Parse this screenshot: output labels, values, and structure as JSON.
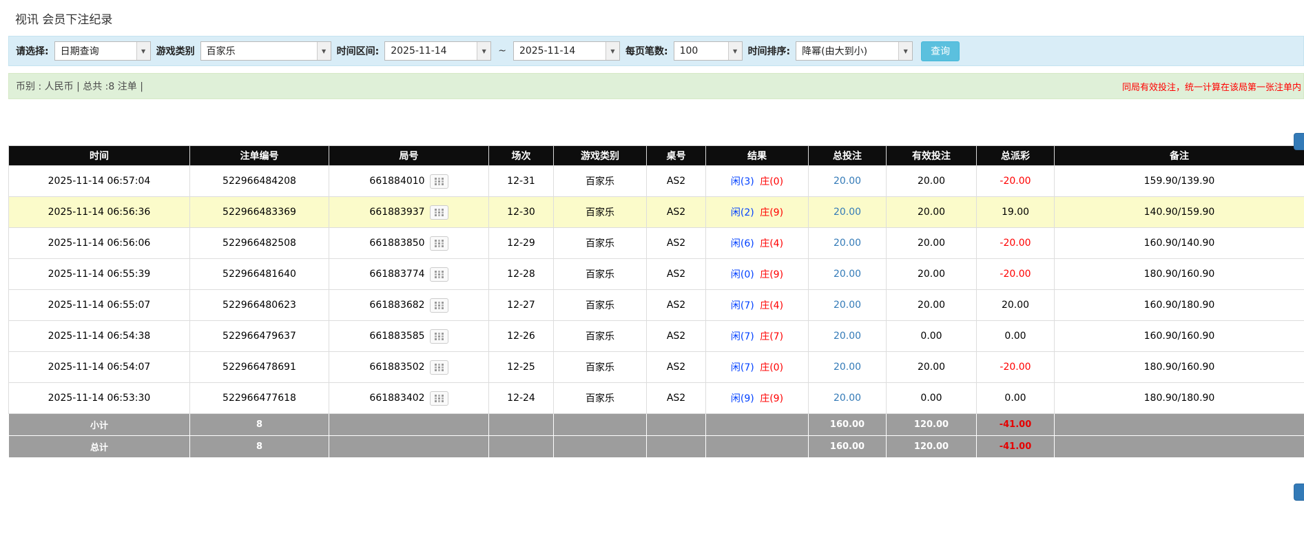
{
  "page": {
    "title": "视讯 会员下注纪录"
  },
  "filter": {
    "select_label": "请选择:",
    "select_value": "日期查询",
    "game_type_label": "游戏类别",
    "game_type_value": "百家乐",
    "time_range_label": "时间区间:",
    "date_from": "2025-11-14",
    "range_separator": "~",
    "date_to": "2025-11-14",
    "page_size_label": "每页笔数:",
    "page_size_value": "100",
    "sort_label": "时间排序:",
    "sort_value": "降幂(由大到小)",
    "search_button": "查询",
    "dropdown_arrow": "▼"
  },
  "summary": {
    "left": "币别 : 人民币 | 总共 :8 注单 |",
    "right_notice": "同局有效投注，统一计算在该局第一张注单内"
  },
  "table": {
    "headers": [
      "时间",
      "注单编号",
      "局号",
      "场次",
      "游戏类别",
      "桌号",
      "结果",
      "总投注",
      "有效投注",
      "总派彩",
      "备注"
    ],
    "rows": [
      {
        "time": "2025-11-14 06:57:04",
        "bet_id": "522966484208",
        "round": "661884010",
        "session": "12-31",
        "game": "百家乐",
        "table_no": "AS2",
        "result_player": "闲(3)",
        "result_banker": "庄(0)",
        "total_bet": "20.00",
        "valid_bet": "20.00",
        "payout": "-20.00",
        "payout_neg": true,
        "highlight": false,
        "remark": "159.90/139.90"
      },
      {
        "time": "2025-11-14 06:56:36",
        "bet_id": "522966483369",
        "round": "661883937",
        "session": "12-30",
        "game": "百家乐",
        "table_no": "AS2",
        "result_player": "闲(2)",
        "result_banker": "庄(9)",
        "total_bet": "20.00",
        "valid_bet": "20.00",
        "payout": "19.00",
        "payout_neg": false,
        "highlight": true,
        "remark": "140.90/159.90"
      },
      {
        "time": "2025-11-14 06:56:06",
        "bet_id": "522966482508",
        "round": "661883850",
        "session": "12-29",
        "game": "百家乐",
        "table_no": "AS2",
        "result_player": "闲(6)",
        "result_banker": "庄(4)",
        "total_bet": "20.00",
        "valid_bet": "20.00",
        "payout": "-20.00",
        "payout_neg": true,
        "highlight": false,
        "remark": "160.90/140.90"
      },
      {
        "time": "2025-11-14 06:55:39",
        "bet_id": "522966481640",
        "round": "661883774",
        "session": "12-28",
        "game": "百家乐",
        "table_no": "AS2",
        "result_player": "闲(0)",
        "result_banker": "庄(9)",
        "total_bet": "20.00",
        "valid_bet": "20.00",
        "payout": "-20.00",
        "payout_neg": true,
        "highlight": false,
        "remark": "180.90/160.90"
      },
      {
        "time": "2025-11-14 06:55:07",
        "bet_id": "522966480623",
        "round": "661883682",
        "session": "12-27",
        "game": "百家乐",
        "table_no": "AS2",
        "result_player": "闲(7)",
        "result_banker": "庄(4)",
        "total_bet": "20.00",
        "valid_bet": "20.00",
        "payout": "20.00",
        "payout_neg": false,
        "highlight": false,
        "remark": "160.90/180.90"
      },
      {
        "time": "2025-11-14 06:54:38",
        "bet_id": "522966479637",
        "round": "661883585",
        "session": "12-26",
        "game": "百家乐",
        "table_no": "AS2",
        "result_player": "闲(7)",
        "result_banker": "庄(7)",
        "total_bet": "20.00",
        "valid_bet": "0.00",
        "payout": "0.00",
        "payout_neg": false,
        "highlight": false,
        "remark": "160.90/160.90"
      },
      {
        "time": "2025-11-14 06:54:07",
        "bet_id": "522966478691",
        "round": "661883502",
        "session": "12-25",
        "game": "百家乐",
        "table_no": "AS2",
        "result_player": "闲(7)",
        "result_banker": "庄(0)",
        "total_bet": "20.00",
        "valid_bet": "20.00",
        "payout": "-20.00",
        "payout_neg": true,
        "highlight": false,
        "remark": "180.90/160.90"
      },
      {
        "time": "2025-11-14 06:53:30",
        "bet_id": "522966477618",
        "round": "661883402",
        "session": "12-24",
        "game": "百家乐",
        "table_no": "AS2",
        "result_player": "闲(9)",
        "result_banker": "庄(9)",
        "total_bet": "20.00",
        "valid_bet": "0.00",
        "payout": "0.00",
        "payout_neg": false,
        "highlight": false,
        "remark": "180.90/180.90"
      }
    ],
    "footer": [
      {
        "label": "小计",
        "count": "8",
        "total_bet": "160.00",
        "valid_bet": "120.00",
        "payout": "-41.00"
      },
      {
        "label": "总计",
        "count": "8",
        "total_bet": "160.00",
        "valid_bet": "120.00",
        "payout": "-41.00"
      }
    ]
  },
  "colors": {
    "filter_bar_blue": "#d9edf7",
    "summary_green": "#dff0d8",
    "search_button_blue": "#5bc0de",
    "header_black": "#0d0d0d",
    "footer_gray": "#9d9d9d",
    "highlight_yellow": "#fbfbca",
    "link_blue": "#337ab7",
    "player_blue": "#0040ff",
    "banker_red": "#ff0000",
    "negative_red": "#ff0000"
  },
  "icons": {
    "dropdown": "chevron-down",
    "round_cell": "roadmap-grid"
  }
}
